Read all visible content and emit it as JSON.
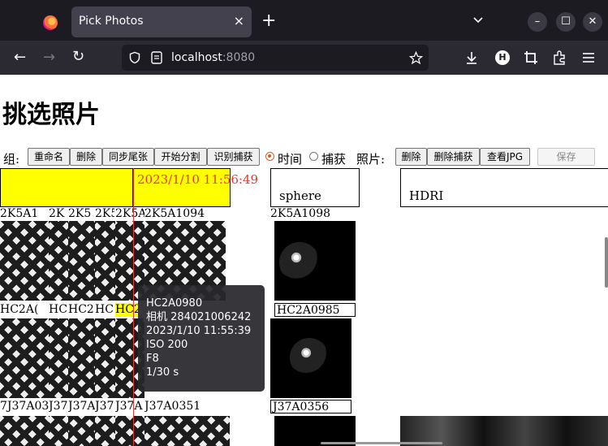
{
  "browser": {
    "tab_title": "Pick Photos",
    "tab_close": "×",
    "new_tab": "+",
    "url_host": "localhost",
    "url_port": ":8080",
    "nav": {
      "back": "←",
      "forward": "→",
      "reload": "↻"
    },
    "window": {
      "minimize": "–",
      "maximize": "☐",
      "close": "✕"
    },
    "avatar_letter": "H"
  },
  "page": {
    "title": "挑选照片",
    "toolbar": {
      "group_label": "组:",
      "buttons": [
        "重命名",
        "删除",
        "同步尾张",
        "开始分割",
        "识别捕获"
      ],
      "sort_time": "时间",
      "sort_capture": "捕获",
      "photo_label": "照片:",
      "photo_buttons": [
        "删除",
        "删除捕获",
        "查看JPG"
      ],
      "save": "保存"
    },
    "groups": {
      "timeline_time": "2023/1/10 11:56:49",
      "sphere": "sphere",
      "hdri": "HDRI"
    },
    "rows": {
      "row1_left": [
        "2K5A1",
        "2K",
        "2K5",
        "2K5",
        "2K5A",
        "2K5A1094"
      ],
      "row1_sphere": "2K5A1098",
      "row2_left": [
        "HC2A(",
        "HC",
        "HC2",
        "HC",
        "HC2",
        ""
      ],
      "row2_sphere": "HC2A0985",
      "row3_left": [
        "7J37A03",
        "J37",
        "J37A",
        "J37",
        "J37A",
        "J37A0351"
      ],
      "row3_sphere": "J37A0356"
    },
    "tooltip": {
      "name": "HC2A0980",
      "camera": "相机 284021006242",
      "time": "2023/1/10 11:55:39",
      "iso": "ISO 200",
      "aperture": "F8",
      "shutter": "1/30 s"
    }
  }
}
